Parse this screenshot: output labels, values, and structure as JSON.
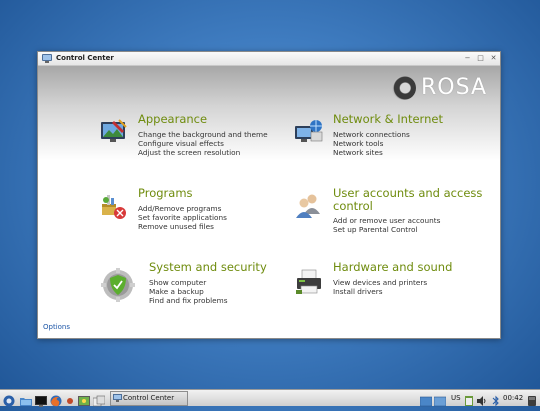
{
  "window": {
    "title": "Control Center",
    "minimize_icon": "minimize-icon",
    "maximize_icon": "maximize-icon",
    "close_icon": "close-icon"
  },
  "brand": {
    "logo_text": "ROSA"
  },
  "categories": [
    {
      "heading": "Appearance",
      "icon": "appearance-icon",
      "links": [
        "Change the background and theme",
        "Configure visual effects",
        "Adjust the screen resolution"
      ]
    },
    {
      "heading": "Network & Internet",
      "icon": "network-icon",
      "links": [
        "Network connections",
        "Network tools",
        "Network sites"
      ]
    },
    {
      "heading": "Programs",
      "icon": "programs-icon",
      "links": [
        "Add/Remove programs",
        "Set favorite applications",
        "Remove unused files"
      ]
    },
    {
      "heading_line1": "User accounts and access",
      "heading_line2": "control",
      "icon": "user-accounts-icon",
      "links": [
        "Add or remove user accounts",
        "Set up Parental Control"
      ]
    },
    {
      "heading": "System and security",
      "icon": "security-shield-icon",
      "links": [
        "Show computer",
        "Make a backup",
        "Find and fix problems"
      ]
    },
    {
      "heading": "Hardware and sound",
      "icon": "printer-icon",
      "links": [
        "View devices and printers",
        "Install drivers"
      ]
    }
  ],
  "footer": {
    "options_label": "Options"
  },
  "taskbar": {
    "task_label": "Control Center",
    "keyboard_layout": "US",
    "clock": "00:42",
    "accent": "#6f8c0e"
  }
}
